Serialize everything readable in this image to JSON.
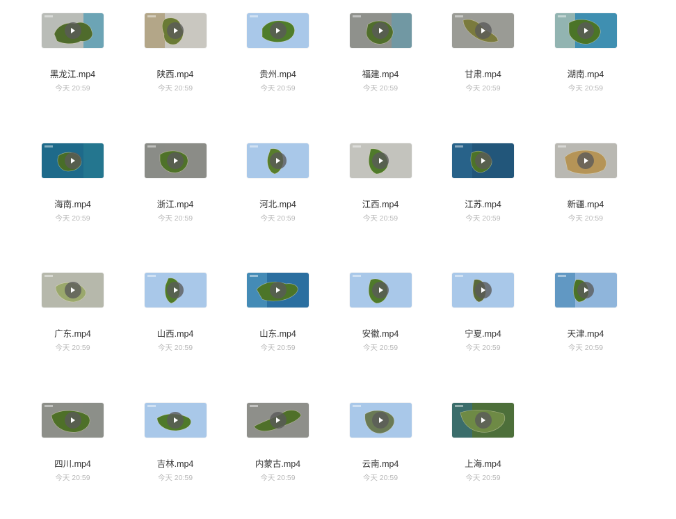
{
  "files": [
    {
      "name": "黑龙江.mp4",
      "time": "今天 20:59",
      "bg": "#b9bcb7",
      "land": "#4f6b2c",
      "water": "#2e8fb5"
    },
    {
      "name": "陕西.mp4",
      "time": "今天 20:59",
      "bg": "#c9c7c0",
      "land": "#6a7a35",
      "water": "#a08a5a"
    },
    {
      "name": "贵州.mp4",
      "time": "今天 20:59",
      "bg": "#a9c8e9",
      "land": "#4f7d2a",
      "water": "#a9c8e9"
    },
    {
      "name": "福建.mp4",
      "time": "今天 20:59",
      "bg": "#8f918c",
      "land": "#506e2c",
      "water": "#5a9fb6"
    },
    {
      "name": "甘肃.mp4",
      "time": "今天 20:59",
      "bg": "#9a9b95",
      "land": "#7a7a3d",
      "water": "#9a9b95"
    },
    {
      "name": "湖南.mp4",
      "time": "今天 20:59",
      "bg": "#3f8fb1",
      "land": "#4b7427",
      "water": "#d7d3b1"
    },
    {
      "name": "海南.mp4",
      "time": "今天 20:59",
      "bg": "#1e6a8a",
      "land": "#486d28",
      "water": "#2a7f93"
    },
    {
      "name": "浙江.mp4",
      "time": "今天 20:59",
      "bg": "#8b8c87",
      "land": "#4f7229",
      "water": "#8b8c87"
    },
    {
      "name": "河北.mp4",
      "time": "今天 20:59",
      "bg": "#a9c8e9",
      "land": "#587d2c",
      "water": "#a9c8e9"
    },
    {
      "name": "江西.mp4",
      "time": "今天 20:59",
      "bg": "#c3c3bd",
      "land": "#4f7a2a",
      "water": "#c3c3bd"
    },
    {
      "name": "江苏.mp4",
      "time": "今天 20:59",
      "bg": "#22567a",
      "land": "#4d7328",
      "water": "#2e6e96"
    },
    {
      "name": "新疆.mp4",
      "time": "今天 20:59",
      "bg": "#b9b8b2",
      "land": "#b59457",
      "water": "#b9b8b2"
    },
    {
      "name": "广东.mp4",
      "time": "今天 20:59",
      "bg": "#b6b8ab",
      "land": "#9aa86c",
      "water": "#b6b8ab"
    },
    {
      "name": "山西.mp4",
      "time": "今天 20:59",
      "bg": "#a9c8e9",
      "land": "#4f7a2a",
      "water": "#a9c8e9"
    },
    {
      "name": "山东.mp4",
      "time": "今天 20:59",
      "bg": "#2b6fa0",
      "land": "#4c7528",
      "water": "#5aa3c9"
    },
    {
      "name": "安徽.mp4",
      "time": "今天 20:59",
      "bg": "#a9c8e9",
      "land": "#4f7a2a",
      "water": "#a9c8e9"
    },
    {
      "name": "宁夏.mp4",
      "time": "今天 20:59",
      "bg": "#a9c8e9",
      "land": "#5a6a3a",
      "water": "#a9c8e9"
    },
    {
      "name": "天津.mp4",
      "time": "今天 20:59",
      "bg": "#8fb5db",
      "land": "#4b7328",
      "water": "#3c7fae"
    },
    {
      "name": "四川.mp4",
      "time": "今天 20:59",
      "bg": "#8d8f89",
      "land": "#4e7028",
      "water": "#8d8f89"
    },
    {
      "name": "吉林.mp4",
      "time": "今天 20:59",
      "bg": "#a9c8e9",
      "land": "#4f7a2a",
      "water": "#a9c8e9"
    },
    {
      "name": "内蒙古.mp4",
      "time": "今天 20:59",
      "bg": "#8e8f8a",
      "land": "#4f7029",
      "water": "#8e8f8a"
    },
    {
      "name": "云南.mp4",
      "time": "今天 20:59",
      "bg": "#a9c8e9",
      "land": "#6a7a55",
      "water": "#a9c8e9"
    },
    {
      "name": "上海.mp4",
      "time": "今天 20:59",
      "bg": "#4d6f3a",
      "land": "#6e8a45",
      "water": "#2e6c94"
    }
  ],
  "colors": {
    "filename_text": "#333333",
    "timestamp_text": "#b8b8b8",
    "play_button": "rgba(90,90,90,0.78)"
  },
  "icons": {
    "play": "play-icon"
  }
}
